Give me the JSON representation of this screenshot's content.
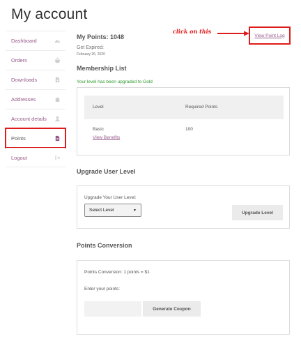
{
  "page": {
    "title": "My account"
  },
  "nav": {
    "items": [
      {
        "label": "Dashboard",
        "icon": "dashboard-icon"
      },
      {
        "label": "Orders",
        "icon": "basket-icon"
      },
      {
        "label": "Downloads",
        "icon": "file-download-icon"
      },
      {
        "label": "Addresses",
        "icon": "home-icon"
      },
      {
        "label": "Account details",
        "icon": "user-icon"
      },
      {
        "label": "Points",
        "icon": "points-file-icon",
        "active": true
      },
      {
        "label": "Logout",
        "icon": "logout-icon"
      }
    ]
  },
  "points": {
    "title": "My Points: 1048",
    "expired_label": "Get Expired:",
    "expired_date": "February 26, 2020",
    "log_link": "View Point Log",
    "annotation": "click on this"
  },
  "membership": {
    "title": "Membership List",
    "upgraded_message": "Your level has been upgraded to Gold",
    "columns": [
      "Level",
      "Required Points"
    ],
    "rows": [
      {
        "level": "Basic",
        "required_points": "100",
        "link": "View Benefits"
      }
    ]
  },
  "upgrade": {
    "title": "Upgrade User Level",
    "field_label": "Upgrade Your User Level:",
    "select_value": "Select Level",
    "button": "Upgrade Level"
  },
  "conversion": {
    "title": "Points Conversion",
    "rate_text": "Points Conversion: 1 points = $1",
    "input_label": "Enter your points:",
    "input_value": "",
    "button": "Generate Coupon"
  },
  "colors": {
    "accent": "#96588a",
    "highlight": "#e01b1b",
    "success": "#2e9a2e"
  }
}
